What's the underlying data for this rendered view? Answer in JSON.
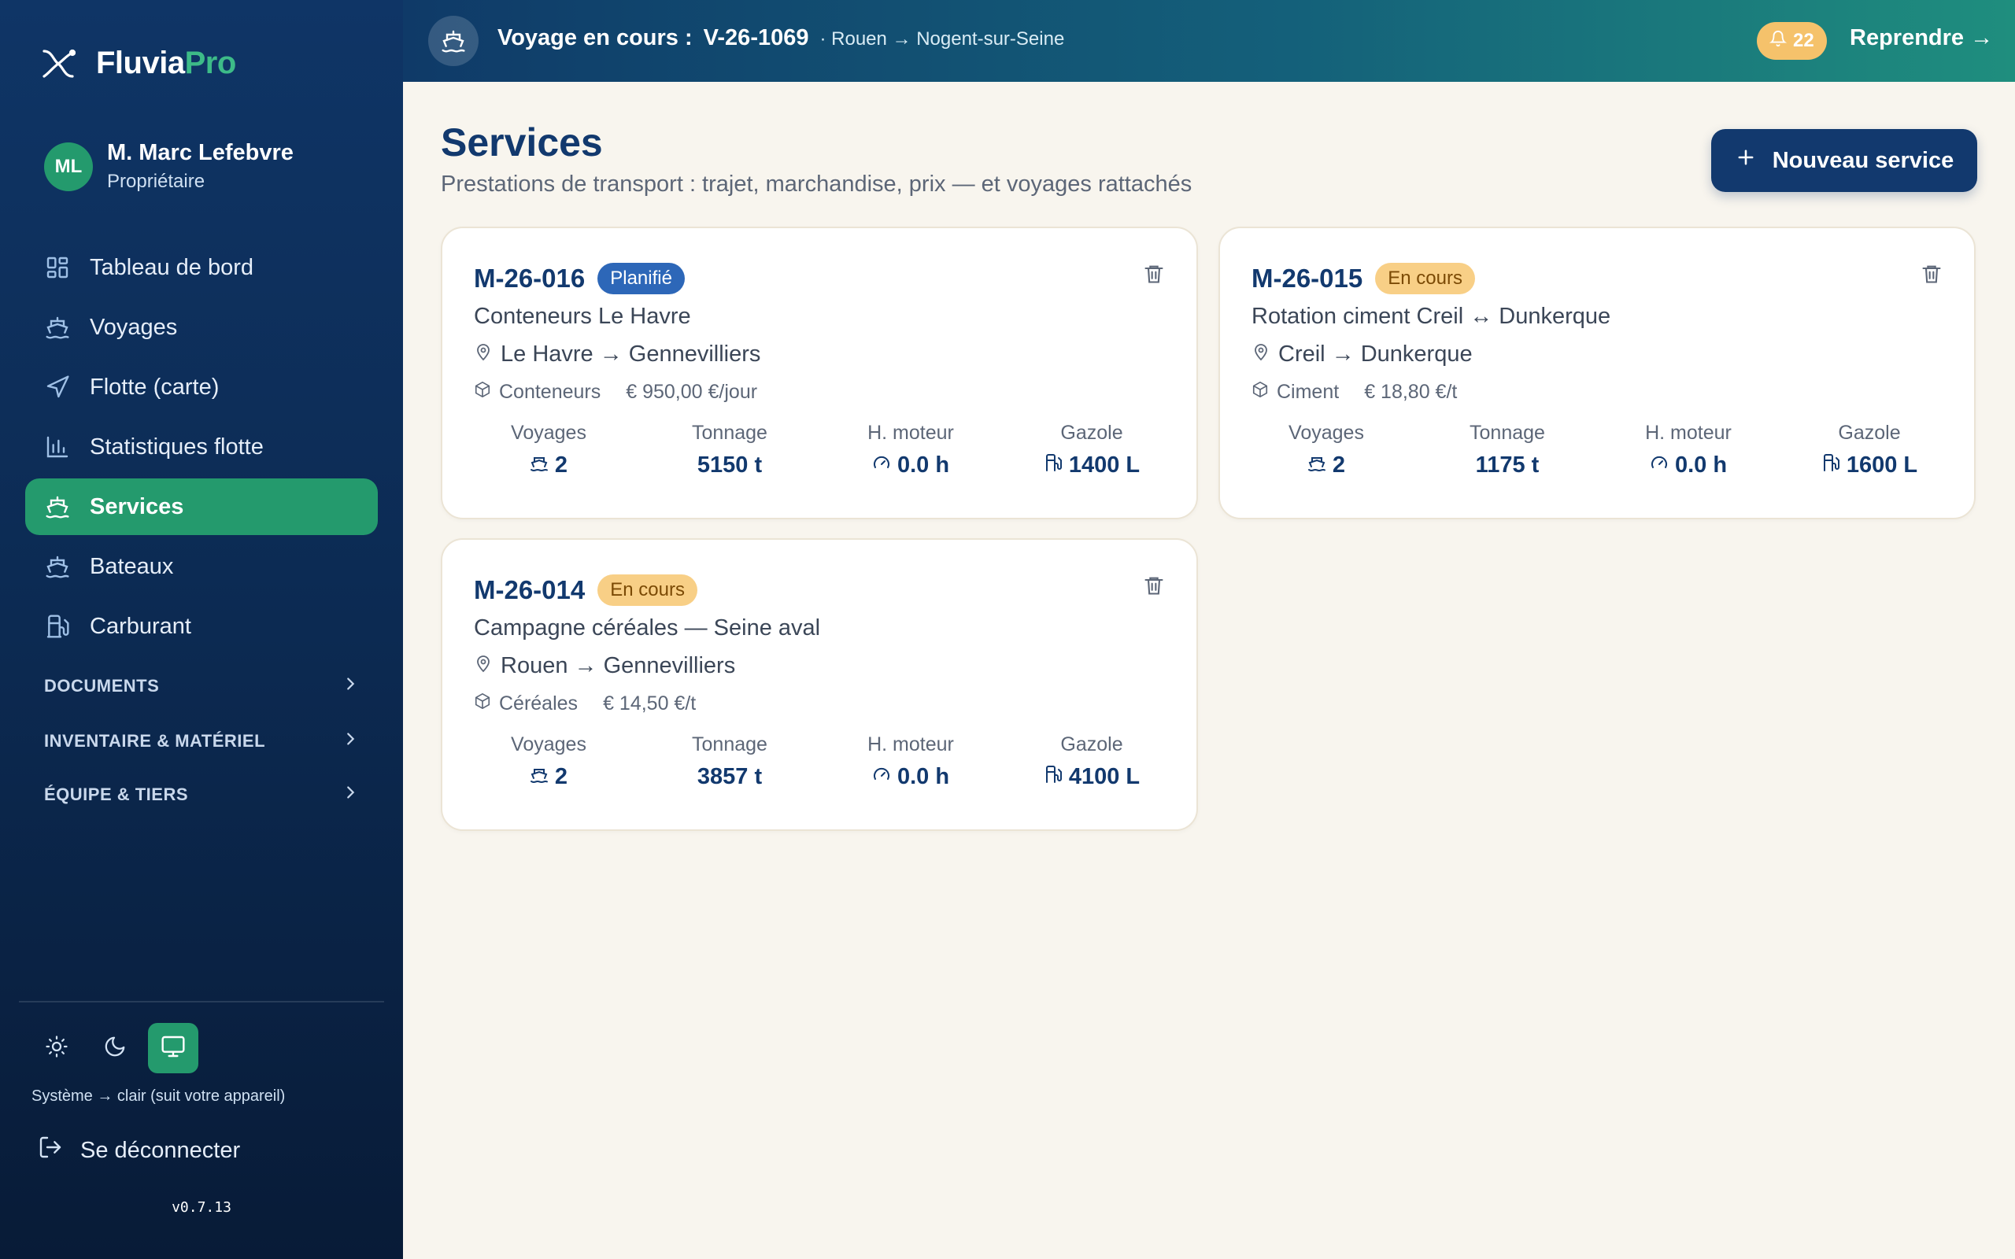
{
  "brand": {
    "name_part1": "Fluvia",
    "name_part2": "Pro"
  },
  "user": {
    "initials": "ML",
    "name": "M. Marc Lefebvre",
    "role": "Propriétaire"
  },
  "nav": {
    "items": [
      {
        "label": "Tableau de bord",
        "icon": "dashboard-icon"
      },
      {
        "label": "Voyages",
        "icon": "boat-icon"
      },
      {
        "label": "Flotte (carte)",
        "icon": "navigation-icon"
      },
      {
        "label": "Statistiques flotte",
        "icon": "bar-chart-icon"
      },
      {
        "label": "Services",
        "icon": "boat-icon",
        "active": true
      },
      {
        "label": "Bateaux",
        "icon": "boat-icon"
      },
      {
        "label": "Carburant",
        "icon": "fuel-icon"
      }
    ],
    "sections": [
      {
        "label": "DOCUMENTS"
      },
      {
        "label": "INVENTAIRE & MATÉRIEL"
      },
      {
        "label": "ÉQUIPE & TIERS"
      }
    ]
  },
  "theme": {
    "caption": "Système → clair (suit votre appareil)",
    "selected": "system"
  },
  "logout_label": "Se déconnecter",
  "version": "v0.7.13",
  "banner": {
    "label": "Voyage en cours :",
    "code": "V-26-1069",
    "route": "· Rouen → Nogent-sur-Seine",
    "notifications": "22",
    "resume_label": "Reprendre →"
  },
  "page": {
    "title": "Services",
    "subtitle": "Prestations de transport : trajet, marchandise, prix — et voyages rattachés",
    "new_button": "Nouveau service"
  },
  "stat_labels": {
    "voyages": "Voyages",
    "tonnage": "Tonnage",
    "engine": "H. moteur",
    "fuel": "Gazole"
  },
  "services": [
    {
      "code": "M-26-016",
      "status": "Planifié",
      "status_type": "planned",
      "title": "Conteneurs Le Havre",
      "route": "Le Havre → Gennevilliers",
      "cargo": "Conteneurs",
      "price": "€ 950,00 €/jour",
      "voyages": "2",
      "tonnage": "5150 t",
      "engine_hours": "0.0 h",
      "fuel": "1400 L"
    },
    {
      "code": "M-26-015",
      "status": "En cours",
      "status_type": "progress",
      "title": "Rotation ciment Creil ↔ Dunkerque",
      "route": "Creil → Dunkerque",
      "cargo": "Ciment",
      "price": "€ 18,80 €/t",
      "voyages": "2",
      "tonnage": "1175 t",
      "engine_hours": "0.0 h",
      "fuel": "1600 L"
    },
    {
      "code": "M-26-014",
      "status": "En cours",
      "status_type": "progress",
      "title": "Campagne céréales — Seine aval",
      "route": "Rouen → Gennevilliers",
      "cargo": "Céréales",
      "price": "€ 14,50 €/t",
      "voyages": "2",
      "tonnage": "3857 t",
      "engine_hours": "0.0 h",
      "fuel": "4100 L"
    }
  ],
  "colors": {
    "accent": "#249a6d",
    "primary": "#12396e",
    "badge_planned": "#2d67b8",
    "badge_progress": "#f8cf86"
  }
}
